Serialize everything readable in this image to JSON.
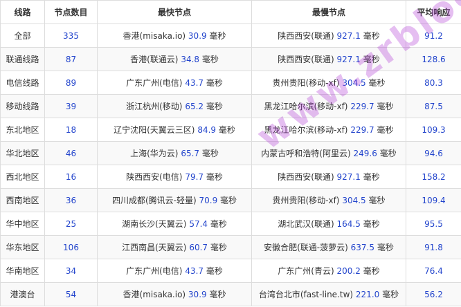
{
  "headers": {
    "route": "线路",
    "count": "节点数目",
    "fastest": "最快节点",
    "slowest": "最慢节点",
    "avg": "平均响应"
  },
  "unit": "毫秒",
  "rows": [
    {
      "route": "全部",
      "count": "335",
      "fast_name": "香港(misaka.io)",
      "fast_ms": "30.9",
      "slow_name": "陕西西安(联通)",
      "slow_ms": "927.1",
      "avg": "91.2"
    },
    {
      "route": "联通线路",
      "count": "87",
      "fast_name": "香港(联通云)",
      "fast_ms": "34.8",
      "slow_name": "陕西西安(联通)",
      "slow_ms": "927.1",
      "avg": "128.6"
    },
    {
      "route": "电信线路",
      "count": "89",
      "fast_name": "广东广州(电信)",
      "fast_ms": "43.7",
      "slow_name": "贵州贵阳(移动-xf)",
      "slow_ms": "304.5",
      "avg": "80.3"
    },
    {
      "route": "移动线路",
      "count": "39",
      "fast_name": "浙江杭州(移动)",
      "fast_ms": "65.2",
      "slow_name": "黑龙江哈尔滨(移动-xf)",
      "slow_ms": "229.7",
      "avg": "87.5"
    },
    {
      "route": "东北地区",
      "count": "18",
      "fast_name": "辽宁沈阳(天翼云三区)",
      "fast_ms": "84.9",
      "slow_name": "黑龙江哈尔滨(移动-xf)",
      "slow_ms": "229.7",
      "avg": "109.3"
    },
    {
      "route": "华北地区",
      "count": "46",
      "fast_name": "上海(华为云)",
      "fast_ms": "65.7",
      "slow_name": "内蒙古呼和浩特(阿里云)",
      "slow_ms": "249.6",
      "avg": "94.6"
    },
    {
      "route": "西北地区",
      "count": "16",
      "fast_name": "陕西西安(电信)",
      "fast_ms": "79.7",
      "slow_name": "陕西西安(联通)",
      "slow_ms": "927.1",
      "avg": "158.2"
    },
    {
      "route": "西南地区",
      "count": "36",
      "fast_name": "四川成都(腾讯云-轻量)",
      "fast_ms": "70.9",
      "slow_name": "贵州贵阳(移动-xf)",
      "slow_ms": "304.5",
      "avg": "109.4"
    },
    {
      "route": "华中地区",
      "count": "25",
      "fast_name": "湖南长沙(天翼云)",
      "fast_ms": "57.4",
      "slow_name": "湖北武汉(联通)",
      "slow_ms": "164.5",
      "avg": "95.5"
    },
    {
      "route": "华东地区",
      "count": "106",
      "fast_name": "江西南昌(天翼云)",
      "fast_ms": "60.7",
      "slow_name": "安徽合肥(联通-菠萝云)",
      "slow_ms": "637.5",
      "avg": "91.8"
    },
    {
      "route": "华南地区",
      "count": "34",
      "fast_name": "广东广州(电信)",
      "fast_ms": "43.7",
      "slow_name": "广东广州(青云)",
      "slow_ms": "200.2",
      "avg": "76.4"
    },
    {
      "route": "港澳台",
      "count": "54",
      "fast_name": "香港(misaka.io)",
      "fast_ms": "30.9",
      "slow_name": "台湾台北市(fast-line.tw)",
      "slow_ms": "221.0",
      "avg": "56.2"
    }
  ],
  "watermark": "www.zrblog.net",
  "colors": {
    "number": "#2244cc",
    "border": "#dddddd",
    "watermark": "#aa28d2"
  }
}
